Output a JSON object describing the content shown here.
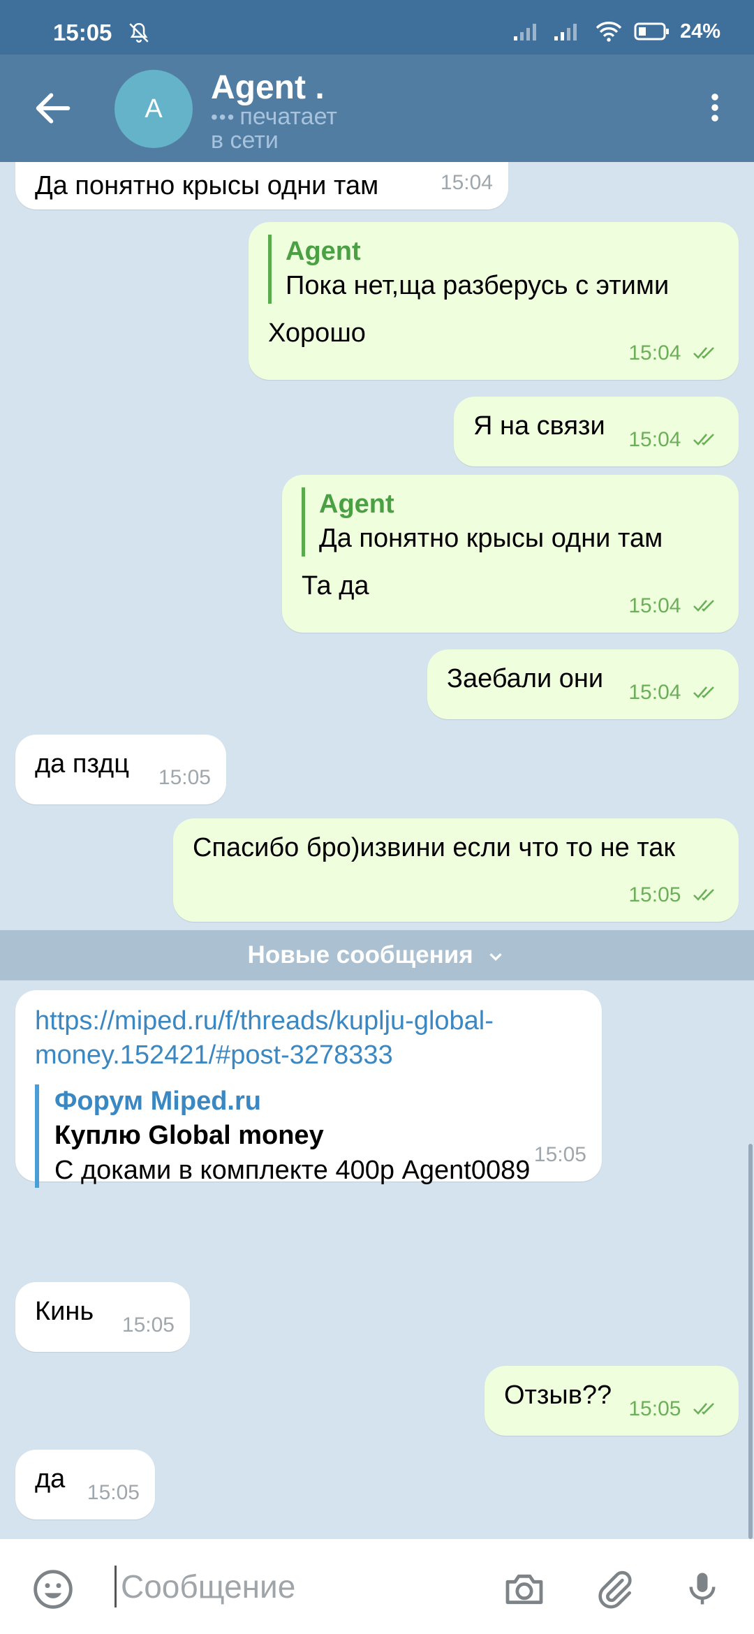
{
  "status_bar": {
    "time": "15:05",
    "battery": "24%"
  },
  "header": {
    "avatar_letter": "A",
    "contact_name": "Agent .",
    "typing_dots": "•••",
    "typing_text": "печатает",
    "online_text": "в сети"
  },
  "messages": [
    {
      "dir": "in",
      "text": "Да понятно крысы одни там",
      "time": "15:04"
    },
    {
      "dir": "out",
      "reply_name": "Agent",
      "reply_text": "Пока нет,ща разберусь с этими",
      "text": "Хорошо",
      "time": "15:04"
    },
    {
      "dir": "out",
      "text": "Я на связи",
      "time": "15:04"
    },
    {
      "dir": "out",
      "reply_name": "Agent",
      "reply_text": "Да понятно крысы одни там",
      "text": "Та да",
      "time": "15:04"
    },
    {
      "dir": "out",
      "text": "Заебали они",
      "time": "15:04"
    },
    {
      "dir": "in",
      "text": "да пздц",
      "time": "15:05"
    },
    {
      "dir": "out",
      "text": "Спасибо бро)извини если что то не так",
      "time": "15:05"
    },
    {
      "dir": "in",
      "link_line1": "https://miped.ru/f/threads/kuplju-global-",
      "link_line2": "money.152421/#post-3278333",
      "preview_site": "Форум Miped.ru",
      "preview_title": "Куплю Global money",
      "preview_desc": "С доками в комплекте 400р  Agent0089",
      "time": "15:05"
    },
    {
      "dir": "in",
      "text": "Кинь",
      "time": "15:05"
    },
    {
      "dir": "out",
      "text": "Отзыв??",
      "time": "15:05"
    },
    {
      "dir": "in",
      "text": "да",
      "time": "15:05"
    }
  ],
  "new_messages_label": "Новые сообщения",
  "input": {
    "placeholder": "Сообщение"
  },
  "colors": {
    "header": "#517da2",
    "status_bar": "#3f709c",
    "outgoing_bubble": "#effedd",
    "incoming_bubble": "#ffffff",
    "accent_green": "#4aa043",
    "link": "#3b87c2"
  }
}
